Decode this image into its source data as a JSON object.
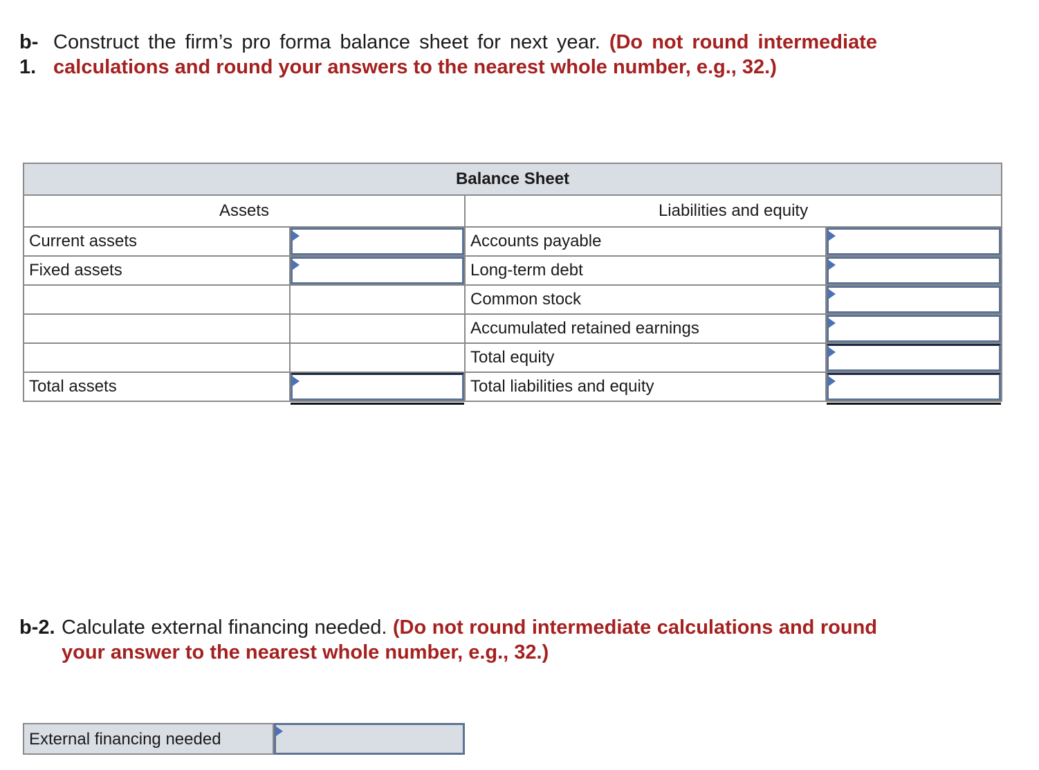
{
  "question_b1": {
    "number_line1": "b-",
    "number_line2": "1.",
    "text": "Construct the firm’s pro forma balance sheet for next year.",
    "instruction": "(Do not round intermediate calculations and round your answers to the nearest whole number, e.g., 32.)"
  },
  "balance_sheet": {
    "title": "Balance Sheet",
    "assets_header": "Assets",
    "liabilities_header": "Liabilities and equity",
    "assets": [
      {
        "label": "Current assets",
        "value": ""
      },
      {
        "label": "Fixed assets",
        "value": ""
      },
      {
        "label": "",
        "value": ""
      },
      {
        "label": "",
        "value": ""
      },
      {
        "label": "",
        "value": ""
      },
      {
        "label": "Total assets",
        "value": ""
      }
    ],
    "liabilities": [
      {
        "label": "Accounts payable",
        "value": ""
      },
      {
        "label": "Long-term debt",
        "value": ""
      },
      {
        "label": "Common stock",
        "value": ""
      },
      {
        "label": "Accumulated retained earnings",
        "value": ""
      },
      {
        "label": "Total equity",
        "value": ""
      },
      {
        "label": "Total liabilities and equity",
        "value": ""
      }
    ]
  },
  "question_b2": {
    "number": "b-2.",
    "text": "Calculate external financing needed.",
    "instruction": "(Do not round intermediate calculations and round your answer to the nearest whole number, e.g., 32.)"
  },
  "external_financing": {
    "label": "External financing needed",
    "value": ""
  }
}
